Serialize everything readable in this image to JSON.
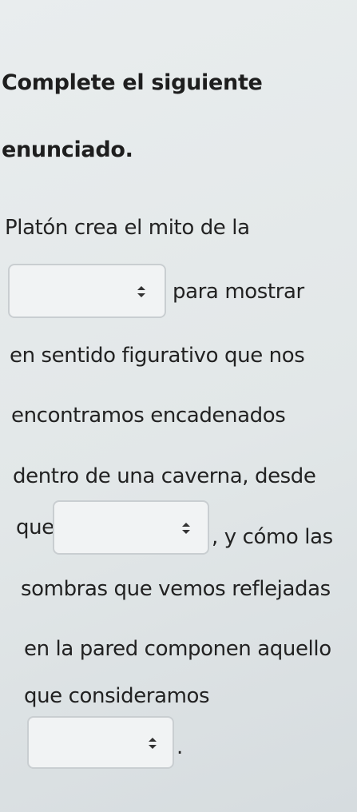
{
  "question": {
    "title_line1": "Complete el siguiente",
    "title_line2": "enunciado.",
    "lines": [
      "Platón crea el mito de la",
      "para mostrar",
      "en sentido figurativo que nos",
      "encontramos encadenados",
      "dentro de una caverna, desde",
      "que",
      ", y cómo las",
      "sombras que vemos reflejadas",
      "en la pared componen aquello",
      "que consideramos",
      "."
    ]
  },
  "dropdowns": [
    {
      "selected": "",
      "icon": "updown-chevron-icon"
    },
    {
      "selected": "",
      "icon": "updown-chevron-icon"
    },
    {
      "selected": "",
      "icon": "updown-chevron-icon"
    }
  ]
}
